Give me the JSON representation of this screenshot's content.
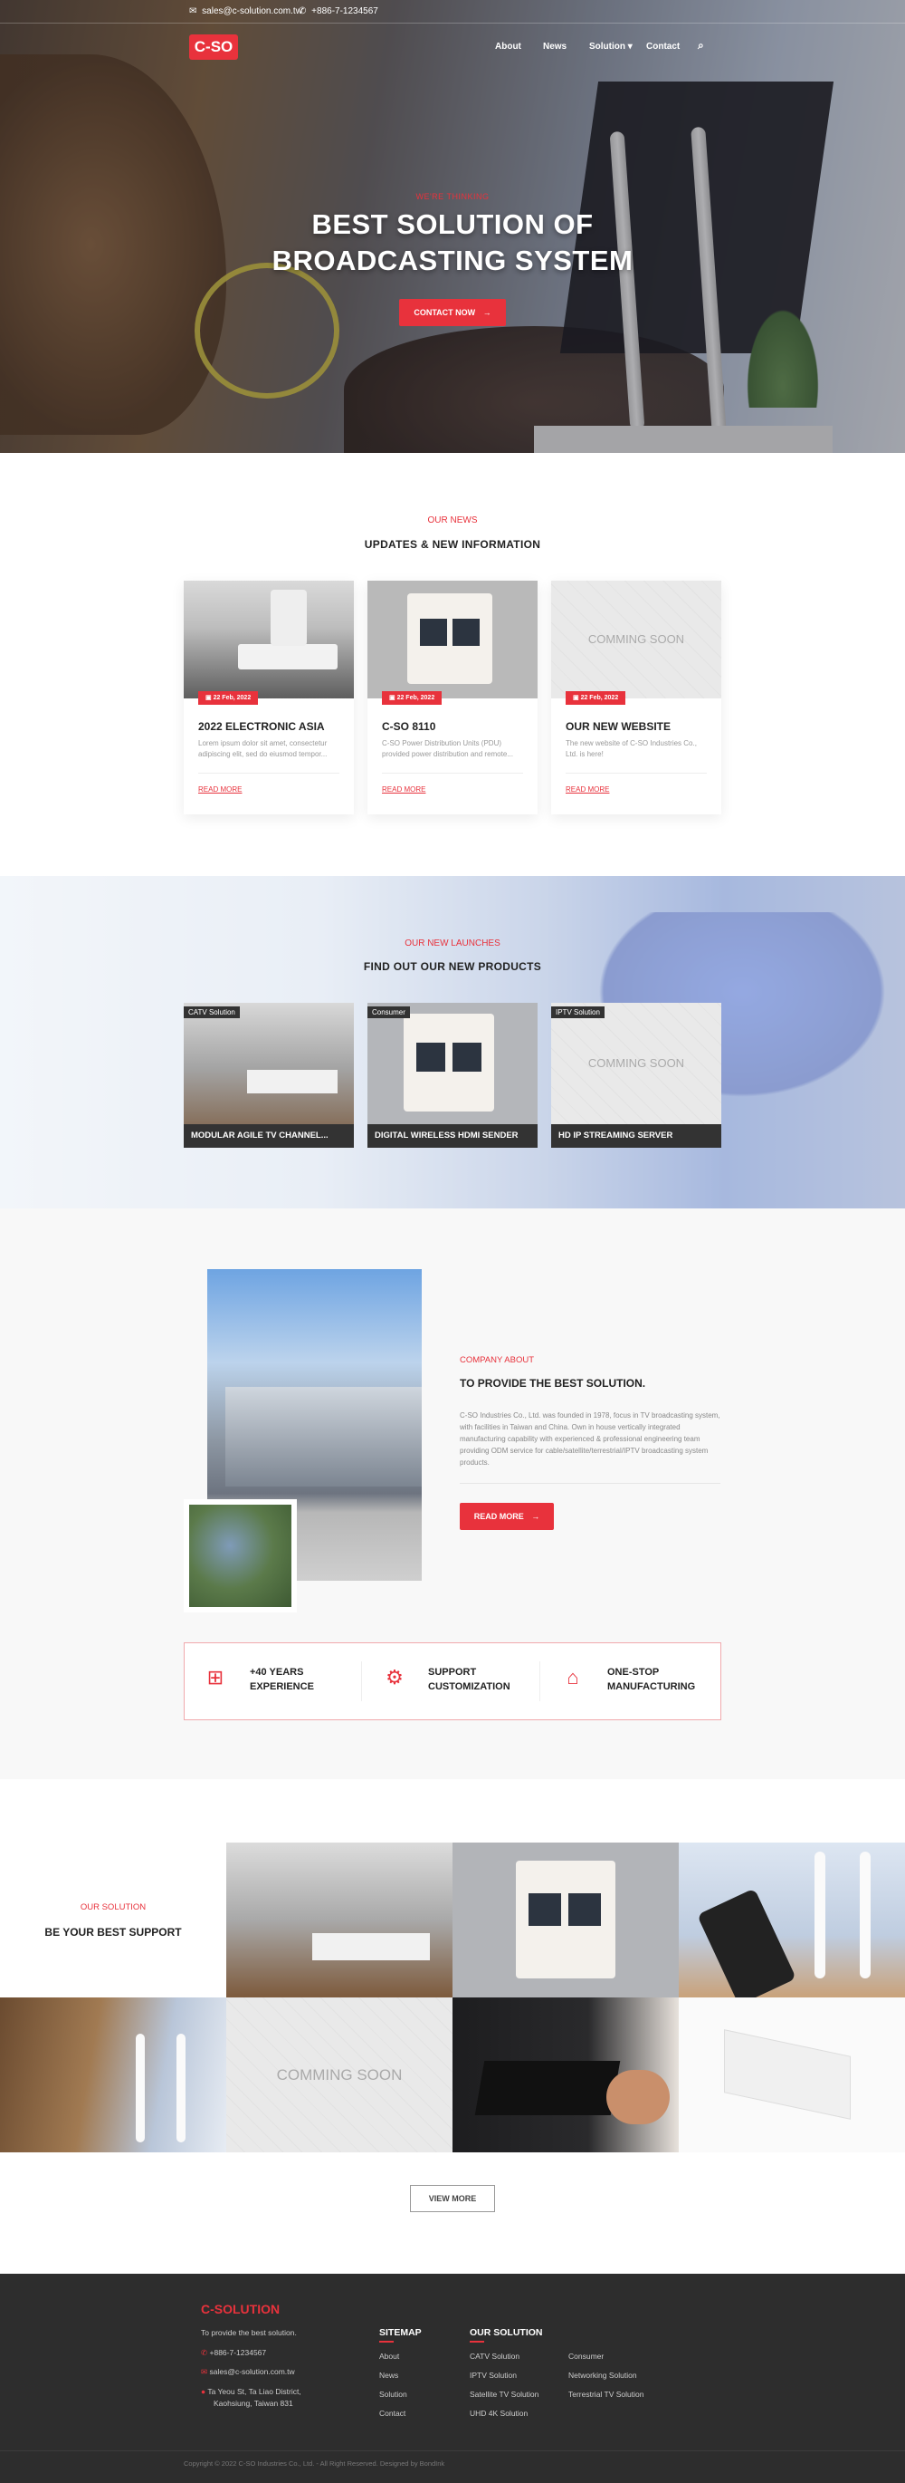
{
  "brand": {
    "logo": "C-SO",
    "accent": "#e8323c"
  },
  "topbar": {
    "email": "sales@c-solution.com.tw",
    "phone": "+886-7-1234567"
  },
  "nav": {
    "items": [
      "About",
      "News",
      "Solution",
      "Contact"
    ]
  },
  "hero": {
    "kicker": "WE'RE THINKING",
    "title_line1": "BEST SOLUTION OF",
    "title_line2": "BROADCASTING SYSTEM",
    "button": "CONTACT NOW"
  },
  "news": {
    "kicker": "OUR NEWS",
    "heading": "UPDATES & NEW INFORMATION",
    "items": [
      {
        "date": "22 Feb, 2022",
        "title": "2022 ELECTRONIC ASIA",
        "desc": "Lorem ipsum dolor sit amet, consectetur adipiscing elit, sed do eiusmod tempor...",
        "more": "READ MORE"
      },
      {
        "date": "22 Feb, 2022",
        "title": "C-SO 8110",
        "desc": "C-SO Power Distribution Units (PDU) provided power distribution and remote...",
        "more": "READ MORE"
      },
      {
        "date": "22 Feb, 2022",
        "title": "OUR NEW WEBSITE",
        "desc": "The new website of C-SO Industries Co., Ltd. is here!",
        "more": "READ MORE",
        "placeholder": "COMMING SOON"
      }
    ]
  },
  "launches": {
    "kicker": "OUR NEW LAUNCHES",
    "heading": "FIND OUT OUR NEW PRODUCTS",
    "items": [
      {
        "tag": "CATV Solution",
        "name": "MODULAR AGILE TV CHANNEL..."
      },
      {
        "tag": "Consumer",
        "name": "DIGITAL WIRELESS HDMI SENDER"
      },
      {
        "tag": "IPTV Solution",
        "name": "HD IP STREAMING SERVER",
        "placeholder": "COMMING SOON"
      }
    ]
  },
  "about": {
    "kicker": "COMPANY ABOUT",
    "heading": "TO PROVIDE THE BEST SOLUTION.",
    "body": "C-SO Industries Co., Ltd. was founded in 1978, focus in TV broadcasting system, with facilities in Taiwan and China. Own in house vertically integrated manufacturing capability with experienced & professional engineering team providing ODM service for cable/satellite/terrestrial/IPTV broadcasting system products.",
    "button": "READ MORE",
    "features": [
      {
        "line1": "+40 YEARS",
        "line2": "EXPERIENCE",
        "icon": "experience-icon"
      },
      {
        "line1": "SUPPORT",
        "line2": "CUSTOMIZATION",
        "icon": "customization-icon"
      },
      {
        "line1": "ONE-STOP",
        "line2": "MANUFACTURING",
        "icon": "manufacturing-icon"
      }
    ]
  },
  "solution": {
    "kicker": "OUR SOLUTION",
    "heading": "BE YOUR BEST SUPPORT",
    "placeholder": "COMMING SOON",
    "button": "VIEW MORE"
  },
  "footer": {
    "brand": "C-SOLUTION",
    "tagline": "To provide the best solution.",
    "phone": "+886-7-1234567",
    "email": "sales@c-solution.com.tw",
    "address_line1": "Ta Yeou St, Ta Liao District,",
    "address_line2": "Kaohsiung, Taiwan 831",
    "sitemap_title": "SITEMAP",
    "sitemap": [
      "About",
      "News",
      "Solution",
      "Contact"
    ],
    "solution_title": "OUR SOLUTION",
    "solutions_col1": [
      "CATV Solution",
      "IPTV Solution",
      "Satellite TV Solution",
      "UHD 4K Solution"
    ],
    "solutions_col2": [
      "Consumer",
      "Networking Solution",
      "Terrestrial TV Solution"
    ],
    "copyright": "Copyright © 2022 C-SO Industries Co., Ltd. - All Right Reserved. Designed by BondInk"
  }
}
